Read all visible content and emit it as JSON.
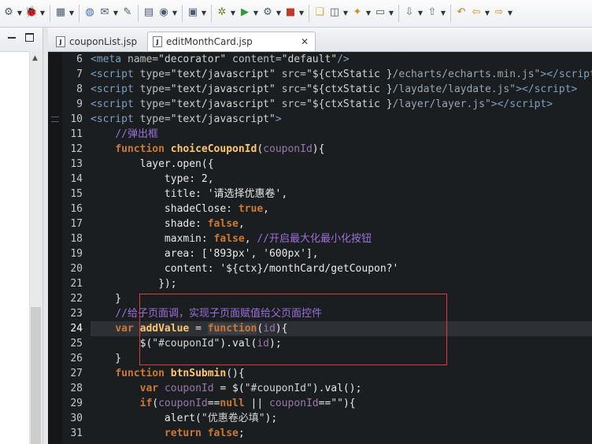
{
  "toolbar": {
    "icons": [
      "run-config-icon",
      "drop",
      "debug-icon",
      "drop",
      "sep",
      "build-icon",
      "drop",
      "sep",
      "globe-icon",
      "mail-icon",
      "drop",
      "edit-icon",
      "sep",
      "package-icon",
      "browser-icon",
      "drop",
      "sep",
      "camera-icon",
      "drop",
      "sep",
      "bug-icon",
      "drop",
      "run-icon",
      "drop",
      "run-config-icon",
      "drop",
      "stop-icon",
      "drop",
      "sep",
      "folder-open-icon",
      "open-type-icon",
      "drop",
      "search-icon",
      "drop",
      "open-file-icon",
      "drop",
      "sep",
      "next-annotation-icon",
      "drop",
      "prev-annotation-icon",
      "drop",
      "sep",
      "last-edit-icon",
      "back-icon",
      "drop",
      "forward-icon",
      "drop"
    ]
  },
  "tabs": [
    {
      "label": "couponList.jsp",
      "active": false
    },
    {
      "label": "editMonthCard.jsp",
      "active": true,
      "close": "✕"
    }
  ],
  "editor": {
    "line_numbers": [
      "6",
      "7",
      "8",
      "9",
      "10",
      "11",
      "12",
      "13",
      "14",
      "15",
      "16",
      "17",
      "18",
      "19",
      "20",
      "21",
      "22",
      "23",
      "24",
      "25",
      "26",
      "27",
      "28",
      "29",
      "30",
      "31"
    ],
    "highlighted_line": "24"
  }
}
